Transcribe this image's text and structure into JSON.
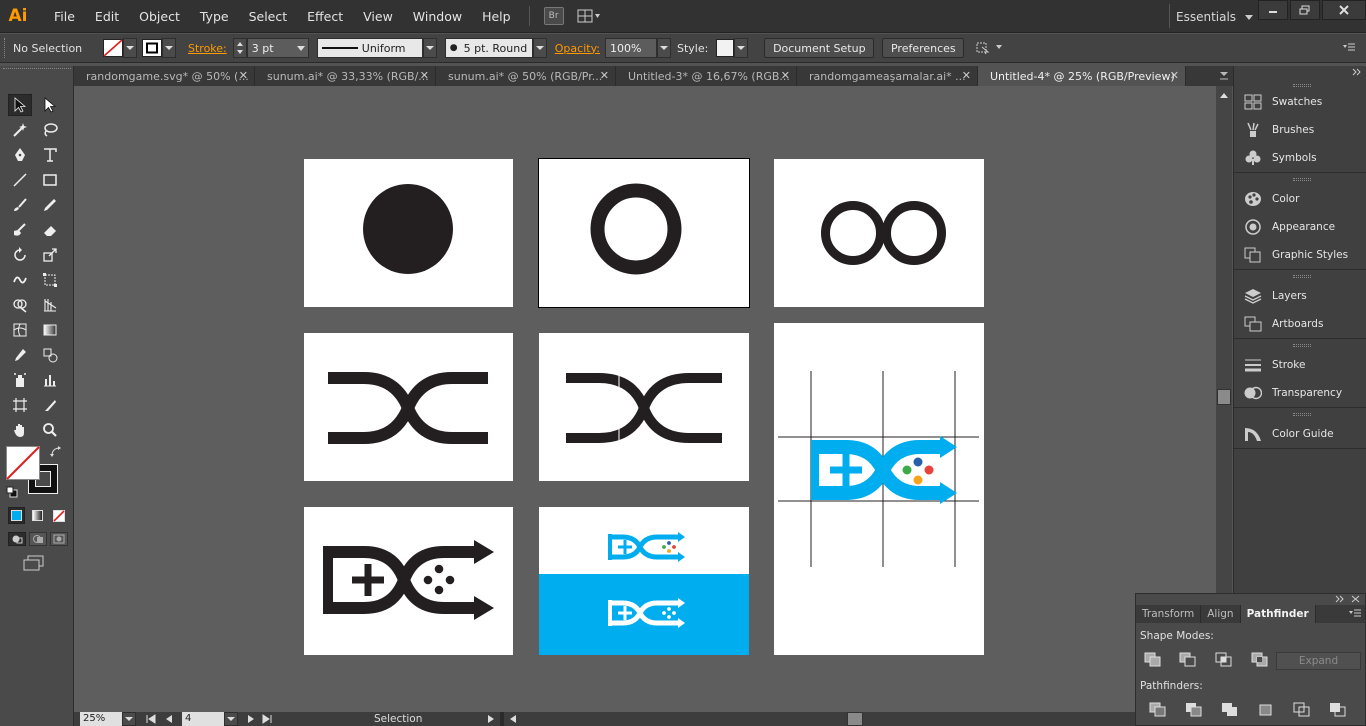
{
  "app": {
    "logo": "Ai"
  },
  "menu": [
    "File",
    "Edit",
    "Object",
    "Type",
    "Select",
    "Effect",
    "View",
    "Window",
    "Help"
  ],
  "bridge_label": "Br",
  "workspace_label": "Essentials",
  "control": {
    "selection_status": "No Selection",
    "stroke_label": "Stroke:",
    "stroke_value": "3 pt",
    "profile_label": "Uniform",
    "brush_label": "5 pt. Round",
    "opacity_label": "Opacity:",
    "opacity_value": "100%",
    "style_label": "Style:",
    "document_setup": "Document Setup",
    "preferences": "Preferences"
  },
  "tabs": [
    {
      "label": "randomgame.svg* @ 50% (..."
    },
    {
      "label": "sunum.ai* @ 33,33% (RGB/..."
    },
    {
      "label": "sunum.ai* @ 50% (RGB/Pr..."
    },
    {
      "label": "Untitled-3* @ 16,67% (RGB..."
    },
    {
      "label": "randomgameaşamalar.ai* ..."
    },
    {
      "label": "Untitled-4* @ 25% (RGB/Preview)"
    }
  ],
  "panels": [
    {
      "label": "Swatches",
      "icon": "swatches-icon"
    },
    {
      "label": "Brushes",
      "icon": "brushes-icon"
    },
    {
      "label": "Symbols",
      "icon": "symbols-icon"
    },
    {
      "label": "Color",
      "icon": "color-icon"
    },
    {
      "label": "Appearance",
      "icon": "appearance-icon"
    },
    {
      "label": "Graphic Styles",
      "icon": "graphic-styles-icon"
    },
    {
      "label": "Layers",
      "icon": "layers-icon"
    },
    {
      "label": "Artboards",
      "icon": "artboards-icon"
    },
    {
      "label": "Stroke",
      "icon": "stroke-icon"
    },
    {
      "label": "Transparency",
      "icon": "transparency-icon"
    },
    {
      "label": "Color Guide",
      "icon": "color-guide-icon"
    }
  ],
  "pathfinder": {
    "tabs": [
      "Transform",
      "Align",
      "Pathfinder"
    ],
    "shape_modes_label": "Shape Modes:",
    "pathfinders_label": "Pathfinders:",
    "expand_label": "Expand"
  },
  "status": {
    "zoom": "25%",
    "artboard_number": "4",
    "tool_name": "Selection"
  },
  "colors": {
    "accent_orange": "#ff9a00",
    "logo_blue": "#00adef",
    "ink": "#231f20",
    "dot_red": "#e8433a",
    "dot_green": "#3eaa47",
    "dot_orange": "#f5a31b",
    "dot_blue": "#2560a8"
  }
}
